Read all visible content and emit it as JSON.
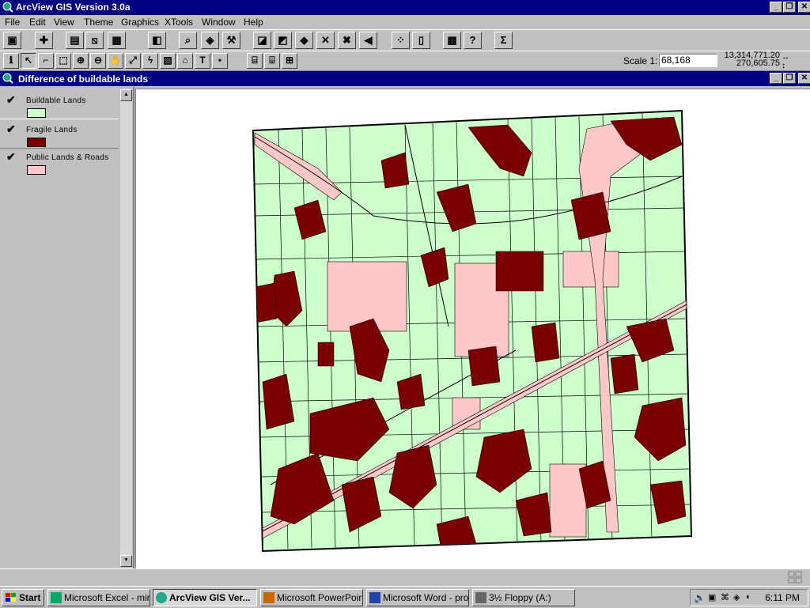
{
  "app": {
    "title": "ArcView GIS Version 3.0a",
    "window_controls": [
      "_",
      "❐",
      "✕"
    ]
  },
  "menu": [
    "File",
    "Edit",
    "View",
    "Theme",
    "Graphics",
    "XTools",
    "Window",
    "Help"
  ],
  "toolbar1_icons": [
    "save-icon",
    "add-theme-icon",
    "theme-properties-icon",
    "edit-legend-icon",
    "open-table-icon",
    "layout-icon",
    "find-icon",
    "locate-icon",
    "query-builder-icon",
    "select-by-theme-icon",
    "select-all-icon",
    "zoom-full-icon",
    "zoom-active-icon",
    "zoom-selected-icon",
    "zoom-previous-icon",
    "identify-results-icon",
    "clear-selection-icon",
    "hot-link-icon",
    "help-icon",
    "summarize-icon"
  ],
  "toolbar2_icons": [
    "identify-tool-icon",
    "pointer-tool-icon",
    "vertex-edit-icon",
    "select-feature-icon",
    "zoom-in-icon",
    "zoom-out-icon",
    "pan-icon",
    "measure-icon",
    "hot-link-tool-icon",
    "area-of-interest-icon",
    "label-tool-icon",
    "text-tool-icon",
    "draw-point-icon",
    "split-line-icon",
    "split-polygon-icon",
    "snap-icon"
  ],
  "scale": {
    "label": "Scale 1:",
    "value": "68,168"
  },
  "coordinates": {
    "x": "13,314,771.20",
    "y": "270,605.75"
  },
  "view": {
    "title": "Difference of buildable lands"
  },
  "legend": [
    {
      "label": "Buildable Lands",
      "color": "#ccffcc",
      "checked": true
    },
    {
      "label": "Fragile Lands",
      "color": "#7a0000",
      "checked": true
    },
    {
      "label": "Public Lands & Roads",
      "color": "#ffc8c8",
      "checked": true
    }
  ],
  "taskbar": {
    "start": "Start",
    "tasks": [
      {
        "label": "Microsoft Excel - min...",
        "icon": "excel-icon",
        "active": false
      },
      {
        "label": "ArcView GIS Ver...",
        "icon": "arcview-icon",
        "active": true
      },
      {
        "label": "Microsoft PowerPoin...",
        "icon": "powerpoint-icon",
        "active": false
      },
      {
        "label": "Microsoft Word - pro...",
        "icon": "word-icon",
        "active": false
      },
      {
        "label": "3½ Floppy (A:)",
        "icon": "floppy-icon",
        "active": false
      }
    ],
    "clock": "6:11 PM"
  },
  "colors": {
    "title_bar": "#000080",
    "buildable": "#ccffcc",
    "fragile": "#7a0000",
    "public": "#ffc8c8"
  }
}
